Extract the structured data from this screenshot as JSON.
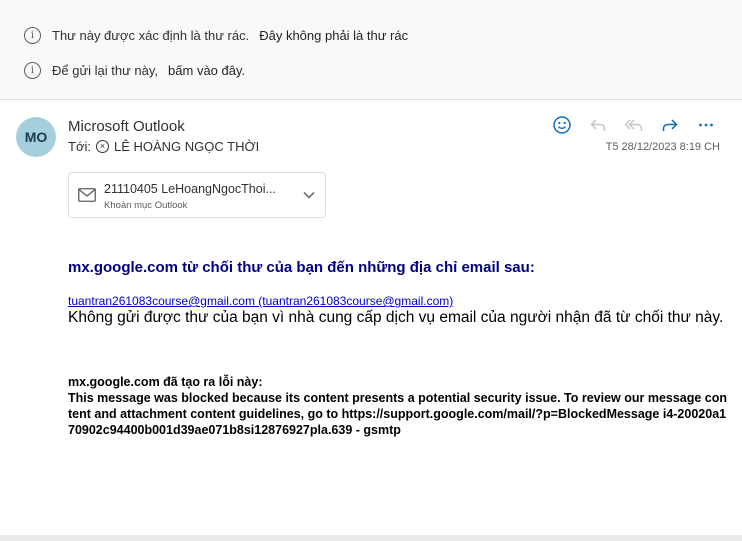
{
  "notices": {
    "junk_text": "Thư này được xác định là thư rác.",
    "not_junk_link": "Đây không phải là thư rác",
    "resend_text": "Để gửi lại thư này,",
    "resend_link": "bấm vào đây."
  },
  "message": {
    "avatar_initials": "MO",
    "sender": "Microsoft Outlook",
    "to_label": "Tới:",
    "recipient": "LÊ HOÀNG NGỌC THỜI",
    "timestamp": "T5 28/12/2023 8:19 CH"
  },
  "attachment": {
    "name": "21110405 LeHoangNgocThoi...",
    "type": "Khoản mục Outlook"
  },
  "body": {
    "heading": "mx.google.com từ chối thư của bạn đến những địa chỉ email sau:",
    "link_text": "tuantran261083course@gmail.com (tuantran261083course@gmail.com)",
    "description": "Không gửi được thư của bạn vì nhà cung cấp dịch vụ email của người nhận đã từ chối thư này.",
    "error_title": "mx.google.com đã tạo ra lỗi này:",
    "error_message": "This message was blocked because its content presents a potential security issue. To review our message content and attachment content guidelines, go to https://support.google.com/mail/?p=BlockedMessage i4-20020a170902c94400b001d39ae071b8si12876927pla.639 - gsmtp"
  },
  "icons": {
    "info": "info-icon",
    "emoji": "emoji-icon",
    "reply": "reply-icon",
    "reply_all": "reply-all-icon",
    "forward": "forward-icon",
    "more": "more-icon",
    "mail": "mail-icon"
  },
  "colors": {
    "accent": "#0f6cbd",
    "heading": "#000080",
    "link": "#0000cc",
    "avatar_bg": "#a6cfde"
  }
}
